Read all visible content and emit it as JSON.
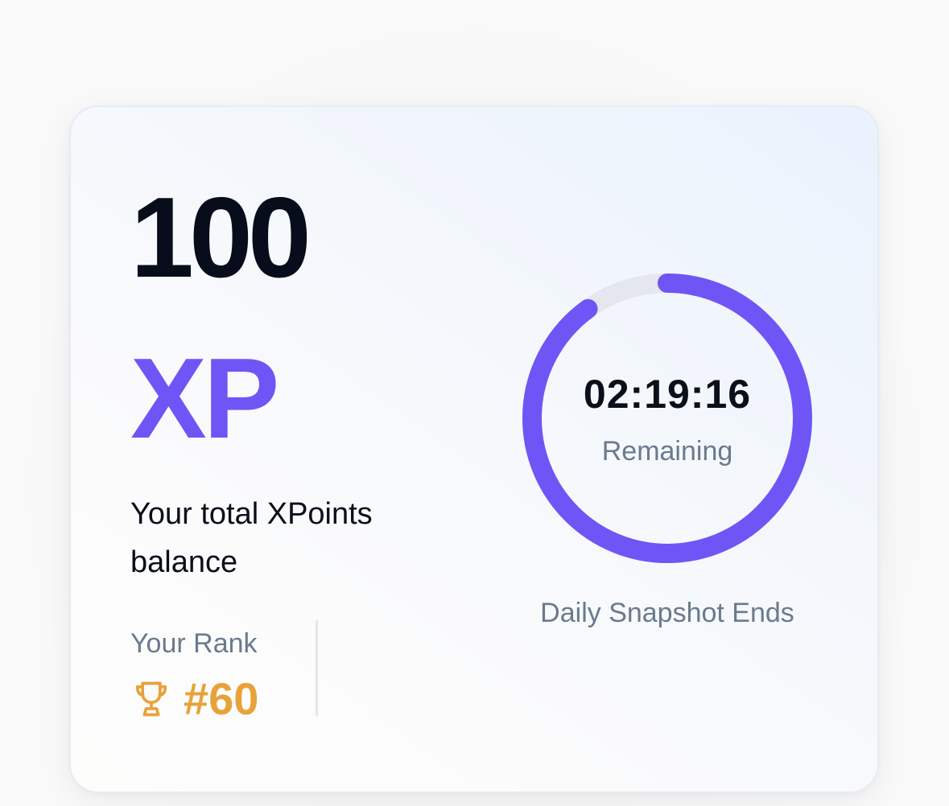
{
  "xp_card": {
    "amount": "100",
    "unit": "XP",
    "caption": "Your total XPoints balance",
    "rank_label": "Your Rank",
    "rank_value": "#60",
    "rank_icon": "trophy-icon"
  },
  "snapshot": {
    "countdown": "02:19:16",
    "countdown_sub": "Remaining",
    "label": "Daily Snapshot Ends",
    "progress_fraction": 0.9
  },
  "colors": {
    "accent": "#6f55f5",
    "rank": "#e8a23a",
    "text_primary": "#070d1a",
    "text_muted": "#6b7a8d",
    "track": "#e4e7ee"
  }
}
